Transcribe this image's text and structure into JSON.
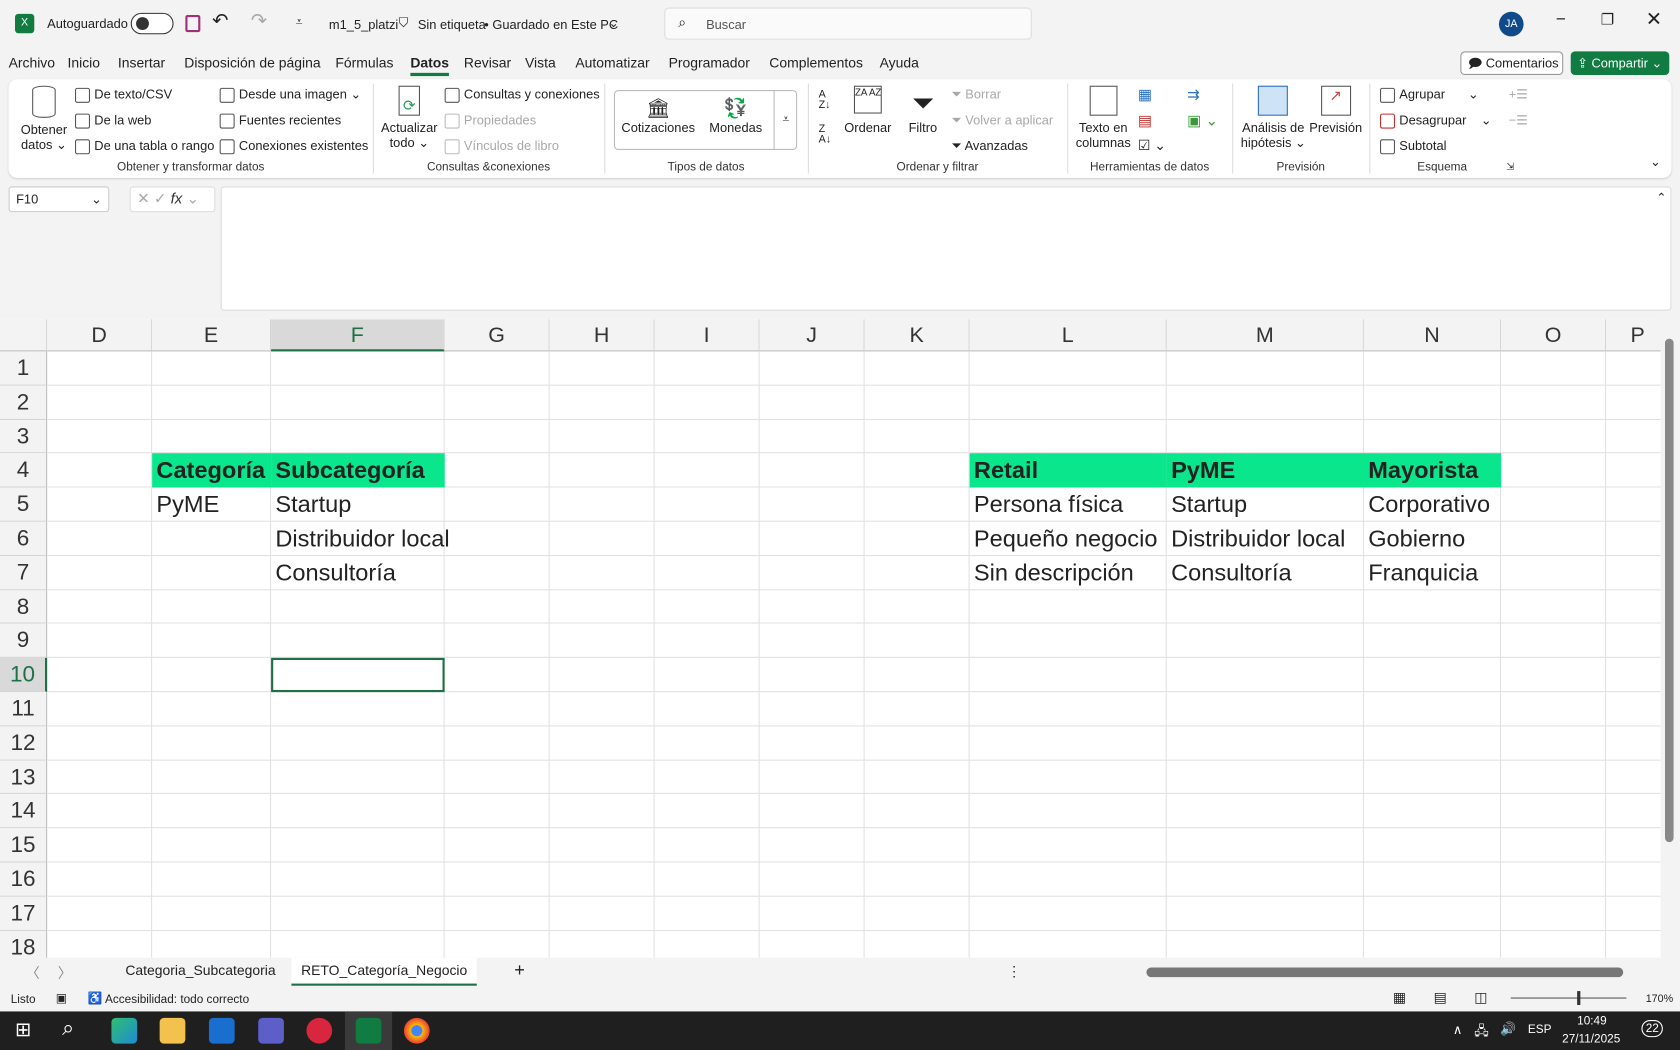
{
  "titlebar": {
    "autosave": "Autoguardado",
    "filename": "m1_5_platzi",
    "label": "Sin etiqueta",
    "saved": "• Guardado en Este PC",
    "search_placeholder": "Buscar",
    "avatar": "JA"
  },
  "menu": [
    "Archivo",
    "Inicio",
    "Insertar",
    "Disposición de página",
    "Fórmulas",
    "Datos",
    "Revisar",
    "Vista",
    "Automatizar",
    "Programador",
    "Complementos",
    "Ayuda"
  ],
  "buttons": {
    "comments": "Comentarios",
    "share": "Compartir"
  },
  "ribbon": {
    "obtener": "Obtener",
    "datos": "datos",
    "de_texto": "De texto/CSV",
    "de_web": "De la web",
    "de_tabla": "De una tabla o rango",
    "desde_imagen": "Desde una imagen",
    "fuentes": "Fuentes recientes",
    "conexiones": "Conexiones existentes",
    "g1": "Obtener y transformar datos",
    "actualizar": "Actualizar",
    "todo": "todo",
    "consultas": "Consultas y conexiones",
    "propiedades": "Propiedades",
    "vinculos": "Vínculos de libro",
    "g2": "Consultas &conexiones",
    "cotizaciones": "Cotizaciones",
    "monedas": "Monedas",
    "g3": "Tipos de datos",
    "ordenar": "Ordenar",
    "filtro": "Filtro",
    "borrar": "Borrar",
    "volver": "Volver a aplicar",
    "avanzadas": "Avanzadas",
    "g4": "Ordenar y filtrar",
    "texto_en": "Texto en",
    "columnas": "columnas",
    "g5": "Herramientas de datos",
    "analisis": "Análisis de",
    "hipotesis": "hipótesis",
    "prevision": "Previsión",
    "g6": "Previsión",
    "agrupar": "Agrupar",
    "desagrupar": "Desagrupar",
    "subtotal": "Subtotal",
    "g7": "Esquema"
  },
  "formula": {
    "namebox": "F10",
    "fx": "fx",
    "value": ""
  },
  "grid": {
    "columns": [
      "D",
      "E",
      "F",
      "G",
      "H",
      "I",
      "J",
      "K",
      "L",
      "M",
      "N",
      "O",
      "P"
    ],
    "rows": [
      "1",
      "2",
      "3",
      "4",
      "5",
      "6",
      "7",
      "8",
      "9",
      "10",
      "11",
      "12",
      "13",
      "14",
      "15",
      "16",
      "17",
      "18"
    ],
    "selected": "F10",
    "cells": [
      {
        "ref": "E4",
        "v": "Categoría",
        "header": true
      },
      {
        "ref": "F4",
        "v": "Subcategoría",
        "header": true
      },
      {
        "ref": "E5",
        "v": "PyME"
      },
      {
        "ref": "F5",
        "v": "Startup"
      },
      {
        "ref": "F6",
        "v": "Distribuidor local"
      },
      {
        "ref": "F7",
        "v": "Consultoría"
      },
      {
        "ref": "L4",
        "v": "Retail",
        "header": true
      },
      {
        "ref": "M4",
        "v": "PyME",
        "header": true
      },
      {
        "ref": "N4",
        "v": "Mayorista",
        "header": true
      },
      {
        "ref": "L5",
        "v": "Persona física"
      },
      {
        "ref": "M5",
        "v": "Startup"
      },
      {
        "ref": "N5",
        "v": "Corporativo"
      },
      {
        "ref": "L6",
        "v": "Pequeño negocio"
      },
      {
        "ref": "M6",
        "v": "Distribuidor local"
      },
      {
        "ref": "N6",
        "v": "Gobierno"
      },
      {
        "ref": "L7",
        "v": "Sin descripción"
      },
      {
        "ref": "M7",
        "v": "Consultoría"
      },
      {
        "ref": "N7",
        "v": "Franquicia"
      }
    ],
    "header_color": "#0ae68b"
  },
  "sheets": {
    "tabs": [
      "Categoria_Subcategoria",
      "RETO_Categoría_Negocio"
    ],
    "active": 1
  },
  "status": {
    "ready": "Listo",
    "accessibility": "Accesibilidad: todo correcto",
    "zoom": "170%"
  },
  "taskbar": {
    "lang": "ESP",
    "time": "10:49",
    "date": "27/11/2025",
    "notifications": "22"
  }
}
